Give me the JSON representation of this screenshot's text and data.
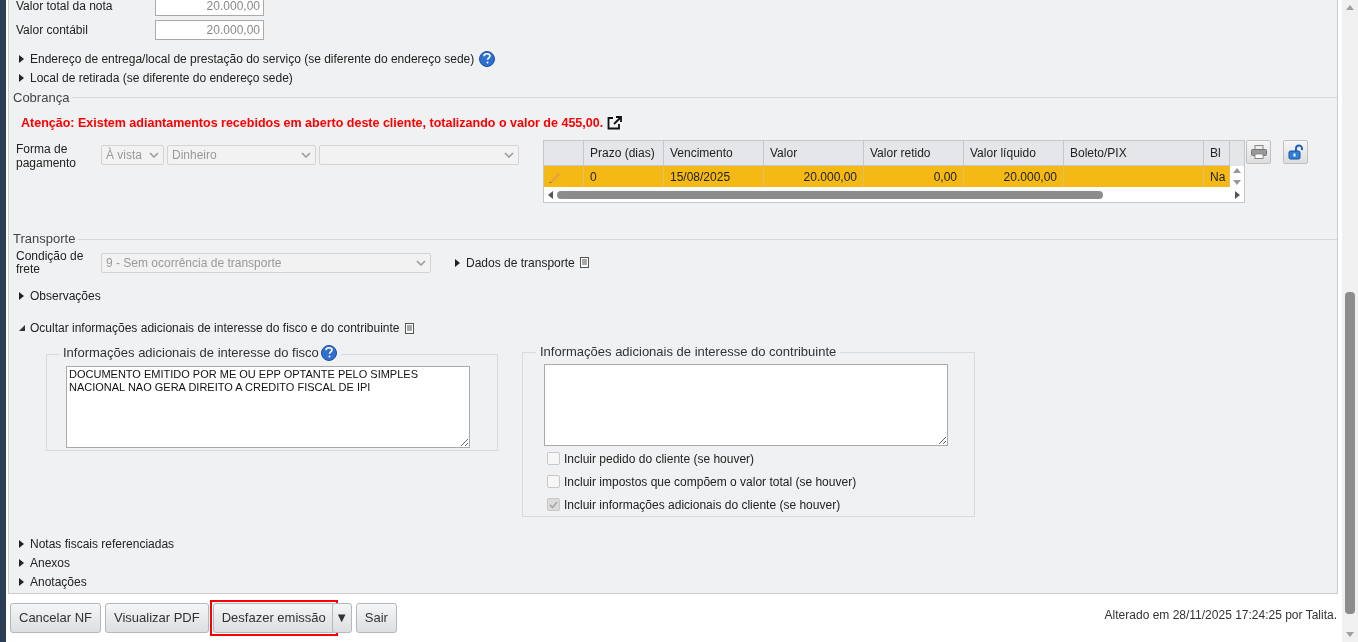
{
  "totals": [
    {
      "label": "Valor total da nota",
      "value": "20.000,00"
    },
    {
      "label": "Valor contábil",
      "value": "20.000,00"
    }
  ],
  "sections_top": [
    {
      "label": "Endereço de entrega/local de prestação do serviço (se diferente do endereço sede)",
      "expanded": false,
      "help": true
    },
    {
      "label": "Local de retirada (se diferente do endereço sede)",
      "expanded": false,
      "help": false
    }
  ],
  "cobranca": {
    "title": "Cobrança",
    "alert": "Atenção: Existem adiantamentos recebidos em aberto deste cliente, totalizando o valor de 455,00.",
    "payment_label": "Forma de pagamento",
    "selects": [
      {
        "kind": "dropdown",
        "value": "À vista"
      },
      {
        "kind": "dropdown",
        "value": "Dinheiro"
      },
      {
        "kind": "dropdown"
      }
    ],
    "grid": {
      "columns": [
        "Prazo (dias)",
        "Vencimento",
        "Valor",
        "Valor retido",
        "Valor líquido",
        "Boleto/PIX",
        "Bl"
      ],
      "rows": [
        {
          "selected": true,
          "cells": [
            "0",
            "15/08/2025",
            "20.000,00",
            "0,00",
            "20.000,00",
            "",
            "Na"
          ]
        }
      ]
    }
  },
  "transporte": {
    "title": "Transporte",
    "freight_label": "Condição de frete",
    "freight_value": "9 - Sem ocorrência de transporte",
    "details": {
      "label": "Dados de transporte",
      "expanded": false
    }
  },
  "sections_mid": [
    {
      "label": "Observações",
      "expanded": false,
      "note_icon": false
    },
    {
      "label": "Ocultar informações adicionais de interesse do fisco e do contribuinte",
      "expanded": true,
      "note_icon": true
    }
  ],
  "fisco": {
    "title": "Informações adicionais de interesse do fisco",
    "text": "DOCUMENTO EMITIDO POR ME OU EPP OPTANTE PELO SIMPLES NACIONAL NAO GERA DIREITO A CREDITO FISCAL DE IPI"
  },
  "contribuinte": {
    "title": "Informações adicionais de interesse do contribuinte",
    "checkboxes": [
      {
        "label": "Incluir pedido do cliente (se houver)",
        "checked": false
      },
      {
        "label": "Incluir impostos que compõem o valor total (se houver)",
        "checked": false
      },
      {
        "label": "Incluir informações adicionais do cliente (se houver)",
        "checked": true
      }
    ]
  },
  "sections_bottom": [
    {
      "label": "Notas fiscais referenciadas",
      "expanded": false
    },
    {
      "label": "Anexos",
      "expanded": false
    },
    {
      "label": "Anotações",
      "expanded": false
    }
  ],
  "footer": {
    "buttons": [
      {
        "label": "Cancelar NF",
        "kind": "button",
        "highlighted": false
      },
      {
        "label": "Visualizar PDF",
        "kind": "button",
        "highlighted": false
      },
      {
        "label": "Desfazer emissão",
        "kind": "button",
        "highlighted": true
      },
      {
        "label": "▼",
        "kind": "menu",
        "highlighted": false
      },
      {
        "label": "Sair",
        "kind": "button",
        "highlighted": false
      }
    ],
    "status": "Alterado em 28/11/2025 17:24:25 por Talita."
  }
}
